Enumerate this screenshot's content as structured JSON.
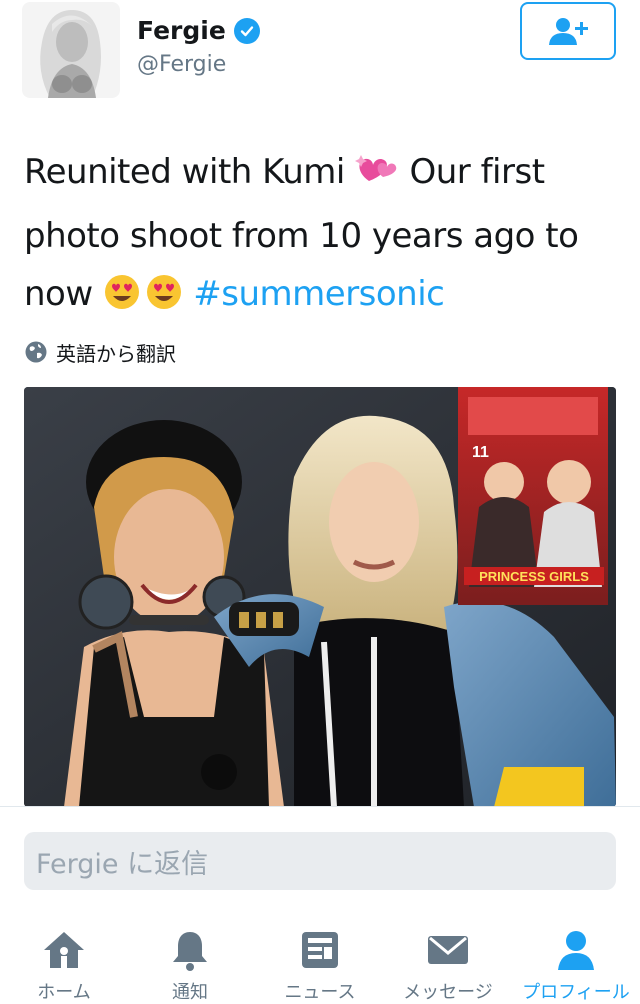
{
  "profile": {
    "name": "Fergie",
    "handle": "@Fergie"
  },
  "tweet": {
    "line1": "Reunited with Kumi",
    "line1_after": " Our first",
    "line2": "photo shoot from 10 years ago to",
    "line3_start": "now ",
    "hashtag": "#summersonic",
    "translate_label": "英語から翻訳"
  },
  "photo": {
    "magazine_banner": "PRINCESS GIRLS",
    "magazine_issue": "11"
  },
  "reply": {
    "placeholder": "Fergie に返信"
  },
  "tabs": [
    {
      "label": "ホーム",
      "icon": "home-icon"
    },
    {
      "label": "通知",
      "icon": "bell-icon"
    },
    {
      "label": "ニュース",
      "icon": "news-icon"
    },
    {
      "label": "メッセージ",
      "icon": "envelope-icon"
    },
    {
      "label": "プロフィール",
      "icon": "person-icon"
    }
  ],
  "colors": {
    "accent": "#1da1f2",
    "text": "#14171a",
    "muted": "#657786"
  }
}
